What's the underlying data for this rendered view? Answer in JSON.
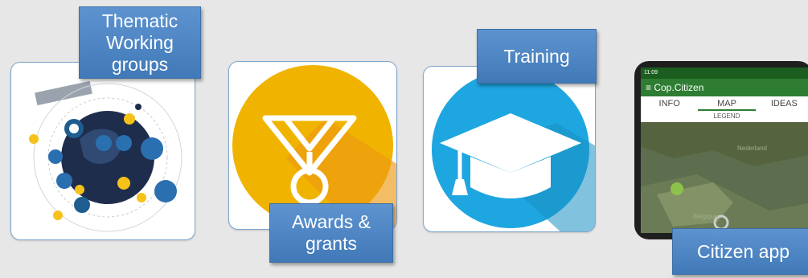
{
  "labels": {
    "thematic": [
      "Thematic",
      "Working",
      "groups"
    ],
    "awards": [
      "Awards &",
      "grants"
    ],
    "training": "Training",
    "citizen_app": "Citizen app"
  },
  "phone": {
    "status_time": "11:09",
    "app_title": "Cop.Citizen",
    "tabs": [
      "INFO",
      "MAP",
      "IDEAS"
    ],
    "legend": "LEGEND",
    "map_labels": [
      "Nederland",
      "Belgique"
    ]
  },
  "colors": {
    "label_bg": "#4a86c5",
    "medal_bg": "#f0b400",
    "training_bg": "#1ea6e0"
  },
  "icons": [
    "copernicus-services-icon",
    "medal-icon",
    "graduation-cap-icon"
  ]
}
